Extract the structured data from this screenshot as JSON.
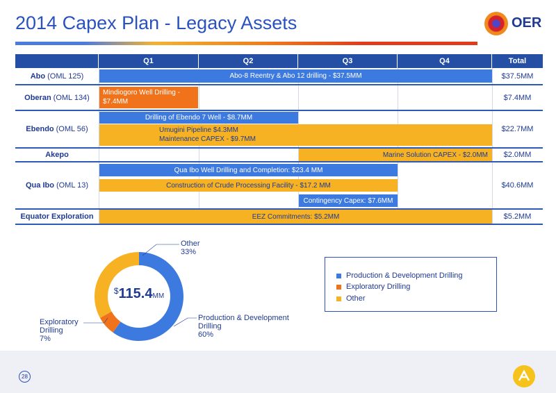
{
  "title": "2014 Capex Plan - Legacy Assets",
  "logo": {
    "text": "OER"
  },
  "table": {
    "headers": [
      "Q1",
      "Q2",
      "Q3",
      "Q4",
      "Total"
    ],
    "rows": {
      "abo": {
        "name": "Abo",
        "sub": "(OML 125)",
        "total": "$37.5MM"
      },
      "oberan": {
        "name": "Oberan",
        "sub": "(OML 134)",
        "total": "$7.4MM"
      },
      "ebendo": {
        "name": "Ebendo",
        "sub": "(OML 56)",
        "total": "$22.7MM"
      },
      "akepo": {
        "name": "Akepo",
        "sub": "",
        "total": "$2.0MM"
      },
      "quaibo": {
        "name": "Qua Ibo",
        "sub": "(OML 13)",
        "total": "$40.6MM"
      },
      "equator": {
        "name": "Equator Exploration",
        "sub": "",
        "total": "$5.2MM"
      }
    },
    "bars": {
      "abo_drilling": "Abo-8 Reentry & Abo 12 drilling - $37.5MM",
      "oberan_line1": "Mindiogoro Well Drilling -",
      "oberan_line2": "$7.4MM",
      "ebendo_well": "Drilling of Ebendo 7 Well - $8.7MM",
      "ebendo_pipeline": "Umugini Pipeline  $4.3MM",
      "ebendo_maint": "Maintenance CAPEX - $9.7MM",
      "akepo_marine": "Marine Solution CAPEX - $2.0MM",
      "quaibo_well": "Qua Ibo Well Drilling and Completion: $23.4 MM",
      "quaibo_crude": "Construction of Crude Processing Facility - $17.2 MM",
      "quaibo_contingency": "Contingency Capex: $7.6MM",
      "equator_eez": "EEZ Commitments: $5.2MM"
    }
  },
  "chart_data": {
    "type": "pie",
    "center_label": {
      "currency": "$",
      "value": "115.4",
      "unit": "MM"
    },
    "slices": [
      {
        "name": "Production & Development Drilling",
        "value": 60,
        "label_line1": "Production & Development",
        "label_line2": "Drilling",
        "pct": "60%",
        "color": "#3d7ae0"
      },
      {
        "name": "Exploratory Drilling",
        "value": 7,
        "label_line1": "Exploratory",
        "label_line2": "Drilling",
        "pct": "7%",
        "color": "#f0731c"
      },
      {
        "name": "Other",
        "value": 33,
        "label_line1": "Other",
        "pct": "33%",
        "color": "#f6b223"
      }
    ],
    "legend": [
      "Production & Development Drilling",
      "Exploratory Drilling",
      "Other"
    ]
  },
  "footer": {
    "page_number": "28"
  }
}
